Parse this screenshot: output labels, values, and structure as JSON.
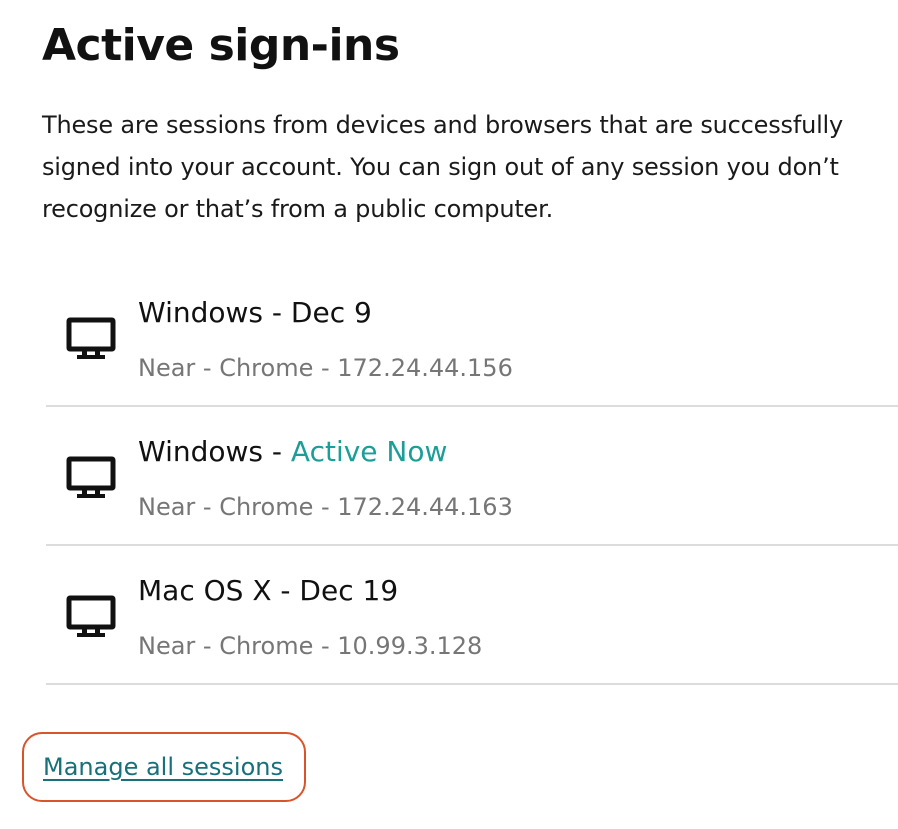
{
  "page": {
    "title": "Active sign-ins",
    "description": "These are sessions from devices and browsers that are successfully signed into your account. You can sign out of any session you don’t recognize or that’s from a public computer."
  },
  "sessions": [
    {
      "os": "Windows",
      "separator": " - ",
      "when": "Dec 9",
      "active": false,
      "details": "Near - Chrome - 172.24.44.156",
      "icon": "desktop-monitor-icon"
    },
    {
      "os": "Windows",
      "separator": " - ",
      "when": "Active Now",
      "active": true,
      "details": "Near - Chrome - 172.24.44.163",
      "icon": "desktop-monitor-icon"
    },
    {
      "os": "Mac OS X",
      "separator": " - ",
      "when": "Dec 19",
      "active": false,
      "details": "Near - Chrome - 10.99.3.128",
      "icon": "desktop-monitor-icon"
    }
  ],
  "manage_link": {
    "label": "Manage all sessions"
  },
  "colors": {
    "active_now": "#1a9e97",
    "link": "#17707a",
    "highlight_border": "#d9532b",
    "divider": "#dcdcdc",
    "muted_text": "#767676"
  }
}
